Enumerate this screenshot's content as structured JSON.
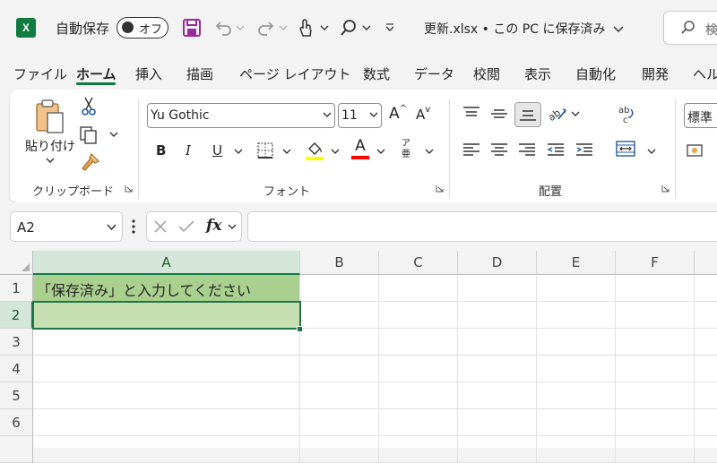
{
  "titlebar": {
    "app_logo": "X",
    "autosave_label": "自動保存",
    "autosave_state": "オフ",
    "filename": "更新.xlsx • この PC に保存済み",
    "search_text": "検"
  },
  "tabs": [
    "ファイル",
    "ホーム",
    "挿入",
    "描画",
    "ページ レイアウト",
    "数式",
    "データ",
    "校閲",
    "表示",
    "自動化",
    "開発",
    "ヘルプ"
  ],
  "active_tab": "ホーム",
  "ribbon": {
    "clipboard": {
      "paste_label": "貼り付け",
      "group_label": "クリップボード"
    },
    "font": {
      "font_name": "Yu Gothic",
      "font_size": "11",
      "grow_label": "A",
      "shrink_label": "A",
      "bold": "B",
      "italic": "I",
      "underline": "U",
      "font_color_label": "A",
      "phonetic_top": "ア",
      "phonetic_bottom": "亜",
      "group_label": "フォント",
      "highlight_color": "#ffff00",
      "font_color": "#ff0000"
    },
    "alignment": {
      "group_label": "配置"
    },
    "number": {
      "format": "標準"
    }
  },
  "formula_bar": {
    "name_box": "A2",
    "fx_label": "fx",
    "formula": ""
  },
  "grid": {
    "columns": [
      "A",
      "B",
      "C",
      "D",
      "E",
      "F"
    ],
    "rows": [
      "1",
      "2",
      "3",
      "4",
      "5",
      "6"
    ],
    "selected_column": "A",
    "selected_row": "2",
    "cells": {
      "A1": "「保存済み」と入力してください",
      "A2": ""
    },
    "fill_colors": {
      "A1": "#a9d08e",
      "A2": "#c6e0b4"
    }
  },
  "colors": {
    "accent": "#107c41"
  }
}
